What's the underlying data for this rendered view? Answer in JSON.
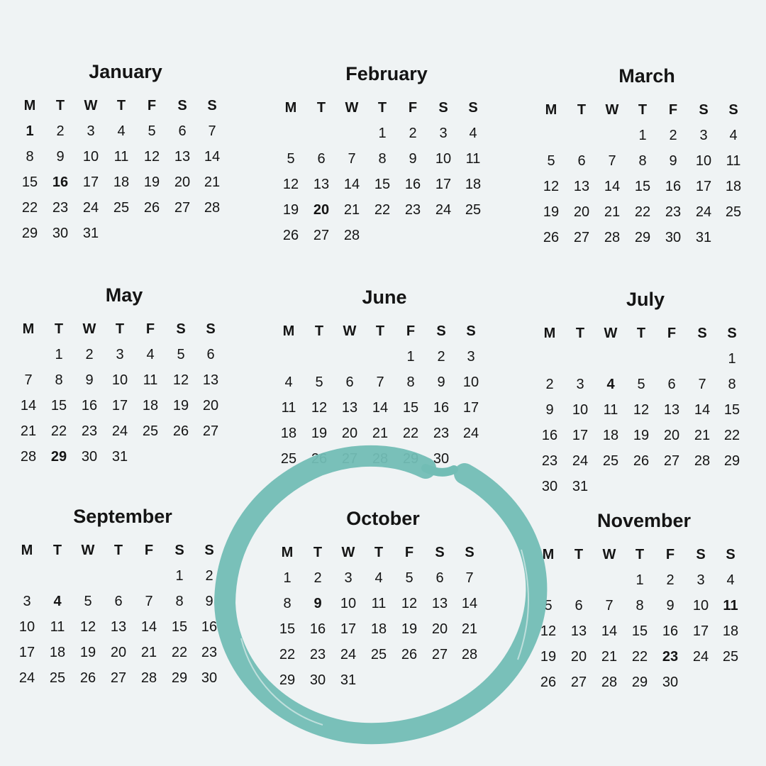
{
  "weekday_labels": [
    "M",
    "T",
    "W",
    "T",
    "F",
    "S",
    "S"
  ],
  "months": [
    {
      "name": "January",
      "weeks": [
        [
          "1",
          "2",
          "3",
          "4",
          "5",
          "6",
          "7"
        ],
        [
          "8",
          "9",
          "10",
          "11",
          "12",
          "13",
          "14"
        ],
        [
          "15",
          "16",
          "17",
          "18",
          "19",
          "20",
          "21"
        ],
        [
          "22",
          "23",
          "24",
          "25",
          "26",
          "27",
          "28"
        ],
        [
          "29",
          "30",
          "31",
          "",
          "",
          "",
          ""
        ]
      ],
      "highlighted": [
        "1",
        "16"
      ]
    },
    {
      "name": "February",
      "weeks": [
        [
          "",
          "",
          "",
          "1",
          "2",
          "3",
          "4"
        ],
        [
          "5",
          "6",
          "7",
          "8",
          "9",
          "10",
          "11"
        ],
        [
          "12",
          "13",
          "14",
          "15",
          "16",
          "17",
          "18"
        ],
        [
          "19",
          "20",
          "21",
          "22",
          "23",
          "24",
          "25"
        ],
        [
          "26",
          "27",
          "28",
          "",
          "",
          "",
          ""
        ]
      ],
      "highlighted": [
        "20"
      ]
    },
    {
      "name": "March",
      "weeks": [
        [
          "",
          "",
          "",
          "1",
          "2",
          "3",
          "4"
        ],
        [
          "5",
          "6",
          "7",
          "8",
          "9",
          "10",
          "11"
        ],
        [
          "12",
          "13",
          "14",
          "15",
          "16",
          "17",
          "18"
        ],
        [
          "19",
          "20",
          "21",
          "22",
          "23",
          "24",
          "25"
        ],
        [
          "26",
          "27",
          "28",
          "29",
          "30",
          "31",
          ""
        ]
      ],
      "highlighted": []
    },
    {
      "name": "May",
      "weeks": [
        [
          "",
          "1",
          "2",
          "3",
          "4",
          "5",
          "6"
        ],
        [
          "7",
          "8",
          "9",
          "10",
          "11",
          "12",
          "13"
        ],
        [
          "14",
          "15",
          "16",
          "17",
          "18",
          "19",
          "20"
        ],
        [
          "21",
          "22",
          "23",
          "24",
          "25",
          "26",
          "27"
        ],
        [
          "28",
          "29",
          "30",
          "31",
          "",
          "",
          ""
        ]
      ],
      "highlighted": [
        "29"
      ]
    },
    {
      "name": "June",
      "weeks": [
        [
          "",
          "",
          "",
          "",
          "1",
          "2",
          "3"
        ],
        [
          "4",
          "5",
          "6",
          "7",
          "8",
          "9",
          "10"
        ],
        [
          "11",
          "12",
          "13",
          "14",
          "15",
          "16",
          "17"
        ],
        [
          "18",
          "19",
          "20",
          "21",
          "22",
          "23",
          "24"
        ],
        [
          "25",
          "26",
          "27",
          "28",
          "29",
          "30",
          ""
        ]
      ],
      "highlighted": []
    },
    {
      "name": "July",
      "weeks": [
        [
          "",
          "",
          "",
          "",
          "",
          "",
          "1"
        ],
        [
          "2",
          "3",
          "4",
          "5",
          "6",
          "7",
          "8"
        ],
        [
          "9",
          "10",
          "11",
          "12",
          "13",
          "14",
          "15"
        ],
        [
          "16",
          "17",
          "18",
          "19",
          "20",
          "21",
          "22"
        ],
        [
          "23",
          "24",
          "25",
          "26",
          "27",
          "28",
          "29"
        ],
        [
          "30",
          "31",
          "",
          "",
          "",
          "",
          ""
        ]
      ],
      "highlighted": [
        "4"
      ]
    },
    {
      "name": "September",
      "weeks": [
        [
          "",
          "",
          "",
          "",
          "",
          "1",
          "2"
        ],
        [
          "3",
          "4",
          "5",
          "6",
          "7",
          "8",
          "9"
        ],
        [
          "10",
          "11",
          "12",
          "13",
          "14",
          "15",
          "16"
        ],
        [
          "17",
          "18",
          "19",
          "20",
          "21",
          "22",
          "23"
        ],
        [
          "24",
          "25",
          "26",
          "27",
          "28",
          "29",
          "30"
        ]
      ],
      "highlighted": [
        "4"
      ]
    },
    {
      "name": "October",
      "weeks": [
        [
          "1",
          "2",
          "3",
          "4",
          "5",
          "6",
          "7"
        ],
        [
          "8",
          "9",
          "10",
          "11",
          "12",
          "13",
          "14"
        ],
        [
          "15",
          "16",
          "17",
          "18",
          "19",
          "20",
          "21"
        ],
        [
          "22",
          "23",
          "24",
          "25",
          "26",
          "27",
          "28"
        ],
        [
          "29",
          "30",
          "31",
          "",
          "",
          "",
          ""
        ]
      ],
      "highlighted": [
        "9"
      ]
    },
    {
      "name": "November",
      "weeks": [
        [
          "",
          "",
          "",
          "1",
          "2",
          "3",
          "4"
        ],
        [
          "5",
          "6",
          "7",
          "8",
          "9",
          "10",
          "11"
        ],
        [
          "12",
          "13",
          "14",
          "15",
          "16",
          "17",
          "18"
        ],
        [
          "19",
          "20",
          "21",
          "22",
          "23",
          "24",
          "25"
        ],
        [
          "26",
          "27",
          "28",
          "29",
          "30",
          "",
          ""
        ]
      ],
      "highlighted": [
        "11",
        "23"
      ]
    }
  ],
  "circled_month": "October",
  "colors": {
    "background": "#eff3f4",
    "text": "#141414",
    "ring": "#72bdb5"
  }
}
